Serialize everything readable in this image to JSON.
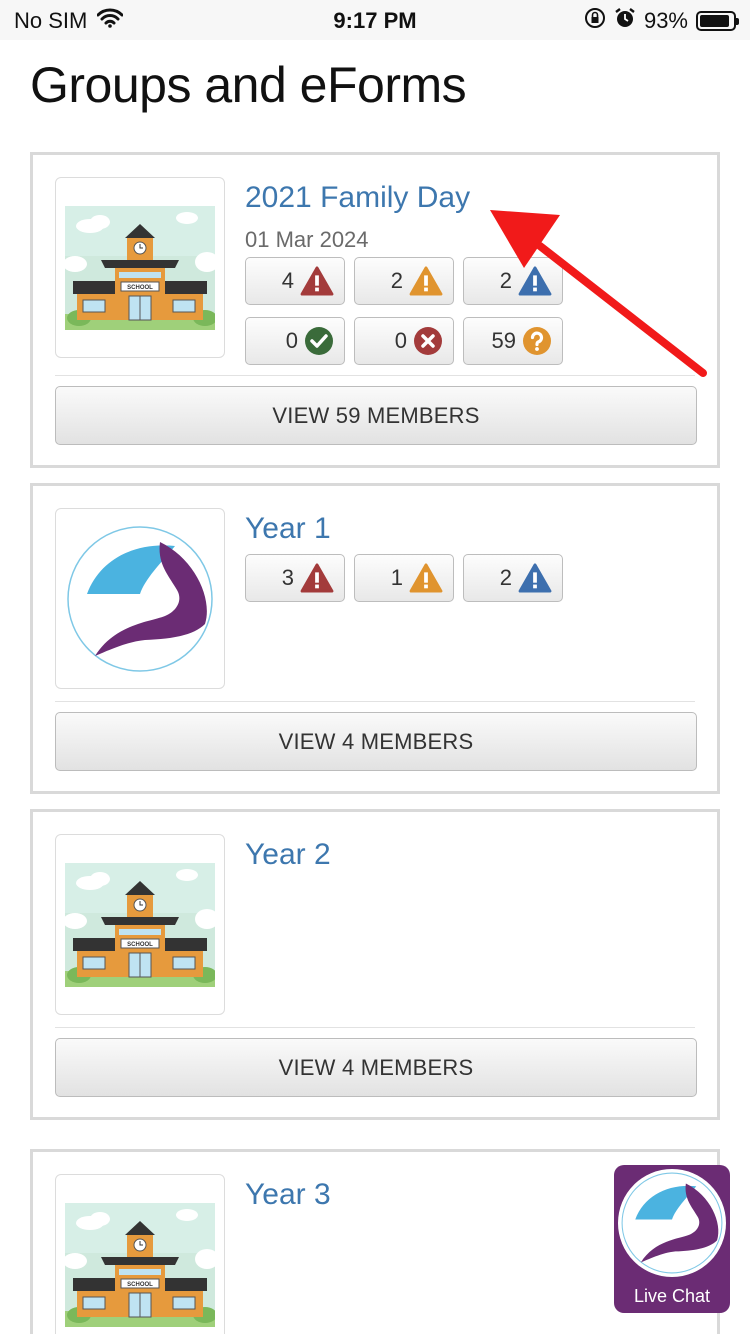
{
  "status_bar": {
    "carrier": "No SIM",
    "time": "9:17 PM",
    "battery_percent": "93%",
    "battery_level": 0.93,
    "icons": [
      "wifi-icon",
      "orientation-lock-icon",
      "alarm-icon",
      "battery-icon"
    ]
  },
  "page": {
    "title": "Groups and eForms"
  },
  "stat_icons": {
    "red_warning": {
      "icon": "warning-triangle-icon",
      "color": "#a33b3b"
    },
    "orange_warning": {
      "icon": "warning-triangle-icon",
      "color": "#e0942f"
    },
    "blue_warning": {
      "icon": "warning-triangle-icon",
      "color": "#3d6fae"
    },
    "accepted": {
      "icon": "check-circle-icon",
      "color": "#3a6b3a"
    },
    "declined": {
      "icon": "x-circle-icon",
      "color": "#a33b3b"
    },
    "unanswered": {
      "icon": "question-circle-icon",
      "color": "#e0942f"
    }
  },
  "groups": [
    {
      "title": "2021 Family Day",
      "date": "01 Mar 2024",
      "thumbnail": "school-building-image",
      "stats_row1": [
        "4",
        "2",
        "2"
      ],
      "stats_row2": [
        "0",
        "0",
        "59"
      ],
      "members_button": "VIEW 59 MEMBERS"
    },
    {
      "title": "Year 1",
      "thumbnail": "school-logo-image",
      "stats_row1": [
        "3",
        "1",
        "2"
      ],
      "members_button": "VIEW 4 MEMBERS"
    },
    {
      "title": "Year 2",
      "thumbnail": "school-building-image",
      "members_button": "VIEW 4 MEMBERS"
    },
    {
      "title": "Year 3",
      "thumbnail": "school-building-image"
    }
  ],
  "live_chat": {
    "label": "Live Chat"
  },
  "colors": {
    "link_blue": "#3d77ae",
    "brand_purple": "#6b2c74",
    "brand_cyan": "#4bb3e0",
    "annotation_red": "#f11a1a"
  }
}
